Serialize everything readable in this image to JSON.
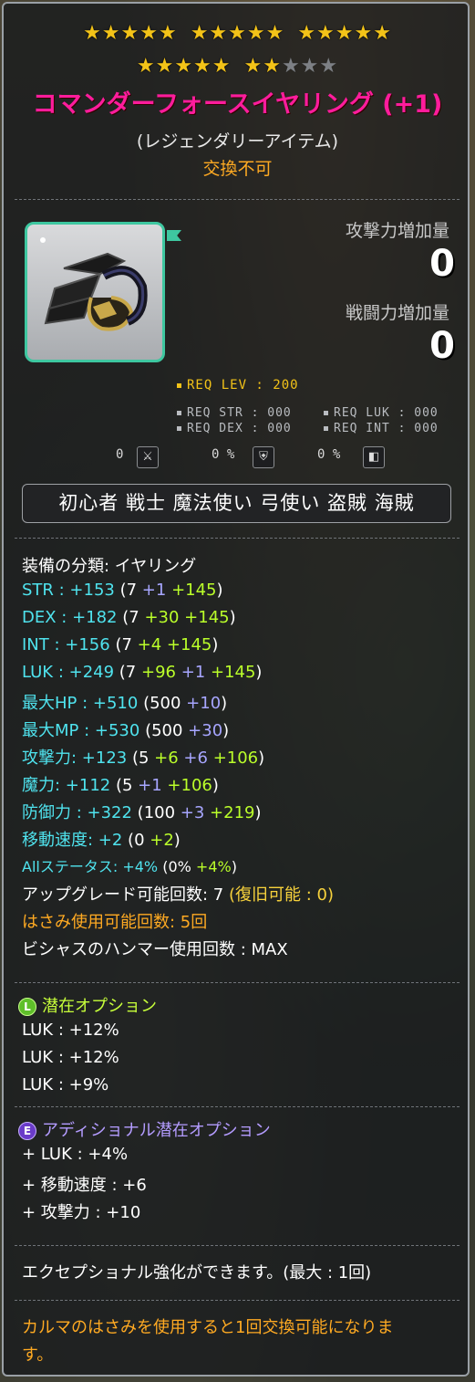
{
  "stars": {
    "filled": 20,
    "total": 25
  },
  "item": {
    "name": "コマンダーフォースイヤリング (+1)",
    "rarity": "(レジェンダリーアイテム)",
    "trade": "交換不可",
    "icon": "earring-icon"
  },
  "boost": {
    "attack_label": "攻撃力増加量",
    "attack_value": "0",
    "power_label": "戦闘力増加量",
    "power_value": "0"
  },
  "requirements": {
    "lev": "REQ LEV : 200",
    "str": "REQ STR : 000",
    "luk": "REQ LUK : 000",
    "dex": "REQ DEX : 000",
    "int": "REQ INT : 000"
  },
  "mini_stats": [
    "0",
    "0 %",
    "0 %"
  ],
  "jobs": "初心者 戦士 魔法使い 弓使い 盗賊 海賊",
  "stats": {
    "category": "装備の分類: イヤリング",
    "str": {
      "label": "STR : +153",
      "base": " (7 ",
      "b1": "+1",
      "b2": " +145",
      "end": ")"
    },
    "dex": {
      "label": "DEX : +182",
      "base": " (7 ",
      "b1": "+30",
      "b2": " +145",
      "end": ")"
    },
    "int": {
      "label": "INT : +156",
      "base": " (7 ",
      "b1": "+4",
      "b2": " +145",
      "end": ")"
    },
    "luk": {
      "label": "LUK : +249",
      "base": " (7 ",
      "b1": "+96",
      "b1b": " +1",
      "b2": " +145",
      "end": ")"
    },
    "hp": {
      "label": "最大HP : +510",
      "base": " (500 ",
      "b1": "+10",
      "end": ")"
    },
    "mp": {
      "label": "最大MP : +530",
      "base": " (500 ",
      "b1": "+30",
      "end": ")"
    },
    "atk": {
      "label": "攻撃力: +123",
      "base": " (5 ",
      "b1": "+6",
      "b1b": " +6",
      "b2": " +106",
      "end": ")"
    },
    "matk": {
      "label": "魔力: +112",
      "base": " (5 ",
      "b1": "+1",
      "b2": " +106",
      "end": ")"
    },
    "def": {
      "label": "防御力 : +322",
      "base": " (100 ",
      "b1": "+3",
      "b2": " +219",
      "end": ")"
    },
    "speed": {
      "label": "移動速度: +2",
      "base": " (0 ",
      "b1": "+2",
      "end": ")"
    },
    "all": {
      "label": "Allステータス: +4%",
      "base": " (0% ",
      "b1": "+4%",
      "end": ")"
    },
    "upgrade": "アップグレード可能回数: 7",
    "upgrade_recover": " (復旧可能 : 0)",
    "scissors": "はさみ使用可能回数: 5回",
    "hammer": "ビシャスのハンマー使用回数 : MAX"
  },
  "potential": {
    "badge": "L",
    "title": "潜在オプション",
    "lines": [
      "LUK : +12%",
      "LUK : +12%",
      "LUK : +9%"
    ]
  },
  "additional": {
    "badge": "E",
    "title": "アディショナル潜在オプション",
    "lines": [
      "+ LUK : +4%",
      "+ 移動速度 : +6",
      "+ 攻撃力 : +10"
    ]
  },
  "exceptional": "エクセプショナル強化ができます。(最大 : 1回)",
  "karma_note_1": "カルマのはさみを使用すると1回交換可能になりま",
  "karma_note_2": "す。",
  "colors": {
    "title": "#ff1c9c",
    "star": "#f3c318",
    "stat_main": "#4fe3ee",
    "bonus_green": "#bbff2a",
    "bonus_purple": "#a7a6ff",
    "orange": "#ffaa22"
  }
}
